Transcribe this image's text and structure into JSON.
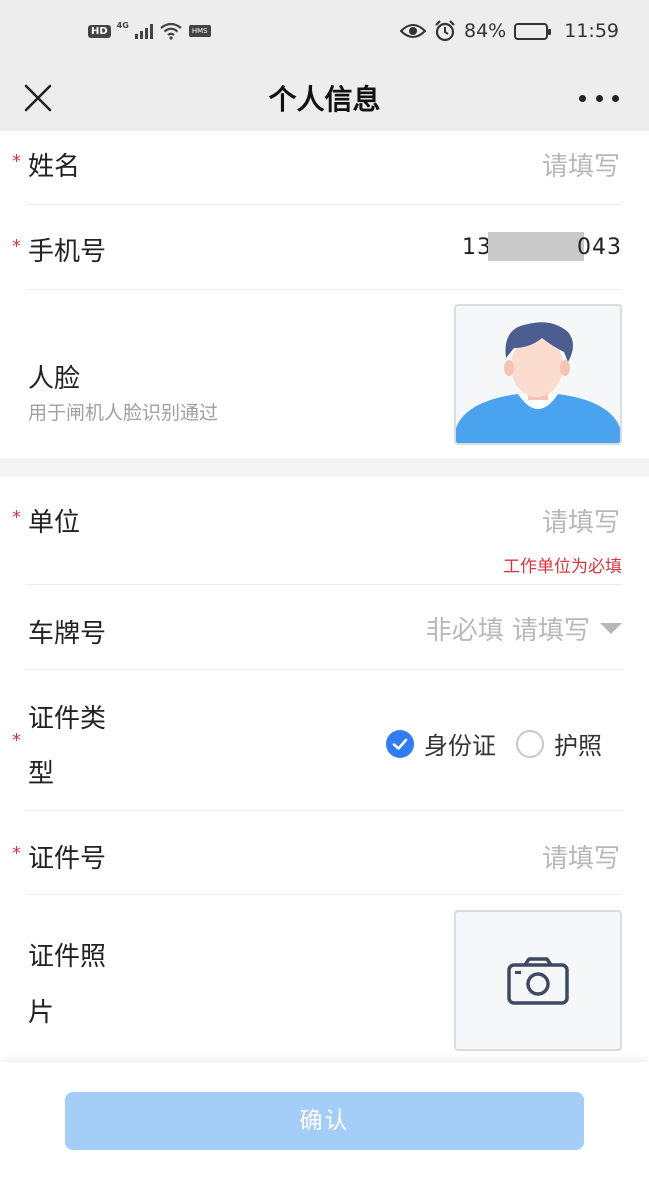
{
  "status_bar": {
    "hd": "HD",
    "network": "4G",
    "hms": "HMS",
    "battery": "84%",
    "battery_fraction": 0.84,
    "time": "11:59"
  },
  "nav": {
    "title": "个人信息"
  },
  "form": {
    "name": {
      "required_mark": "*",
      "label": "姓名",
      "placeholder": "请填写"
    },
    "phone": {
      "required_mark": "*",
      "label": "手机号",
      "value_prefix": "13",
      "value_suffix": "043"
    },
    "face": {
      "label": "人脸",
      "hint": "用于闸机人脸识别通过"
    },
    "unit": {
      "required_mark": "*",
      "label": "单位",
      "placeholder": "请填写",
      "error": "工作单位为必填"
    },
    "plate": {
      "label": "车牌号",
      "placeholder": "非必填 请填写"
    },
    "id_type": {
      "required_mark": "*",
      "label_line1": "证件类",
      "label_line2": "型",
      "options": [
        {
          "label": "身份证",
          "checked": true
        },
        {
          "label": "护照",
          "checked": false
        }
      ]
    },
    "id_number": {
      "required_mark": "*",
      "label": "证件号",
      "placeholder": "请填写"
    },
    "id_photo": {
      "label_line1": "证件照",
      "label_line2": "片"
    }
  },
  "footer": {
    "confirm_label": "确认"
  },
  "colors": {
    "accent": "#2f7df6",
    "required": "#d9363e",
    "button_disabled": "#a4cdf8",
    "placeholder": "#b8b8b8"
  }
}
